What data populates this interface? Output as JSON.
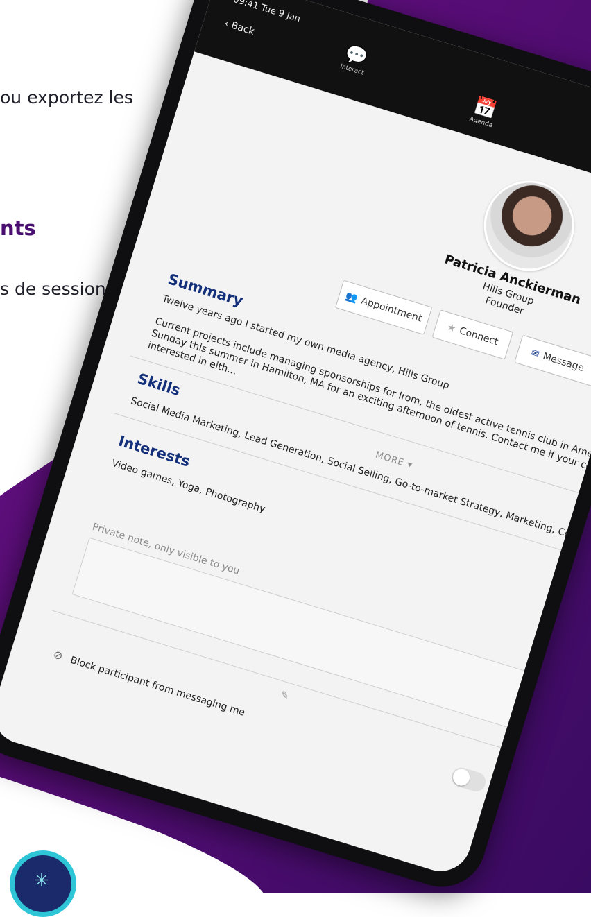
{
  "colors": {
    "brand_purple": "#5a0f7a",
    "deep_purple": "#3a0b62",
    "accent_blue": "#14307a"
  },
  "marketing": {
    "line1": "ou exportez les",
    "heading": "nts",
    "line2": "s de sessions"
  },
  "device": {
    "status_time": "09:41",
    "status_date": "Tue 9 Jan",
    "back_label": "Back"
  },
  "nav": {
    "items": [
      {
        "label": "Interact",
        "icon": "chat-bubbles-icon"
      },
      {
        "label": "Agenda",
        "icon": "calendar-icon"
      }
    ]
  },
  "profile": {
    "name": "Patricia Anckierman",
    "company": "Hills Group",
    "role": "Founder",
    "actions": {
      "appointment": "Appointment",
      "connect": "Connect",
      "message": "Message"
    }
  },
  "summary": {
    "heading": "Summary",
    "line1": "Twelve years ago I started my own media agency, Hills Group",
    "line2": "Current projects include managing sponsorships for Irom, the oldest active tennis club in Ameri",
    "line3": "Sunday this summer in Hamilton, MA for an exciting afternoon of tennis. Contact me if your comp",
    "line4": "interested in eith...",
    "more_label": "MORE"
  },
  "skills": {
    "heading": "Skills",
    "text": "Social Media Marketing, Lead Generation, Social Selling, Go-to-market Strategy, Marketing, Communic"
  },
  "interests": {
    "heading": "Interests",
    "text": "Video games, Yoga, Photography"
  },
  "note": {
    "placeholder": "Private note, only visible to you"
  },
  "block": {
    "label": "Block participant from messaging me"
  }
}
